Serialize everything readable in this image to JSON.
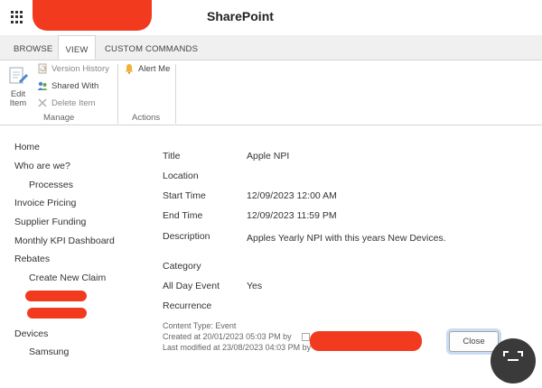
{
  "header": {
    "title": "SharePoint"
  },
  "tabs": [
    {
      "label": "BROWSE"
    },
    {
      "label": "VIEW"
    },
    {
      "label": "CUSTOM COMMANDS"
    }
  ],
  "ribbon": {
    "edit_item_line1": "Edit",
    "edit_item_line2": "Item",
    "version_history": "Version History",
    "shared_with": "Shared With",
    "delete_item": "Delete Item",
    "alert_me": "Alert Me",
    "group_manage": "Manage",
    "group_actions": "Actions"
  },
  "nav": [
    {
      "label": "Home"
    },
    {
      "label": "Who are we?"
    },
    {
      "label": "Processes"
    },
    {
      "label": "Invoice Pricing"
    },
    {
      "label": "Supplier Funding"
    },
    {
      "label": "Monthly KPI Dashboard"
    },
    {
      "label": "Rebates"
    },
    {
      "label": "Create New Claim"
    },
    {
      "label": "Devices"
    },
    {
      "label": "Samsung"
    }
  ],
  "fields": [
    {
      "label": "Title",
      "value": "Apple NPI"
    },
    {
      "label": "Location",
      "value": ""
    },
    {
      "label": "Start Time",
      "value": "12/09/2023 12:00 AM"
    },
    {
      "label": "End Time",
      "value": "12/09/2023 11:59 PM"
    },
    {
      "label": "Description",
      "value": "Apples Yearly NPI with this years New Devices."
    },
    {
      "label": "Category",
      "value": ""
    },
    {
      "label": "All Day Event",
      "value": "Yes"
    },
    {
      "label": "Recurrence",
      "value": ""
    }
  ],
  "meta": {
    "content_type": "Content Type: Event",
    "created": "Created at 20/01/2023 05:03 PM by",
    "modified": "Last modified at 23/08/2023 04:03 PM by"
  },
  "buttons": {
    "close": "Close"
  },
  "colors": {
    "accent_focus": "#c9dcf3",
    "redaction": "#f23a1e"
  }
}
